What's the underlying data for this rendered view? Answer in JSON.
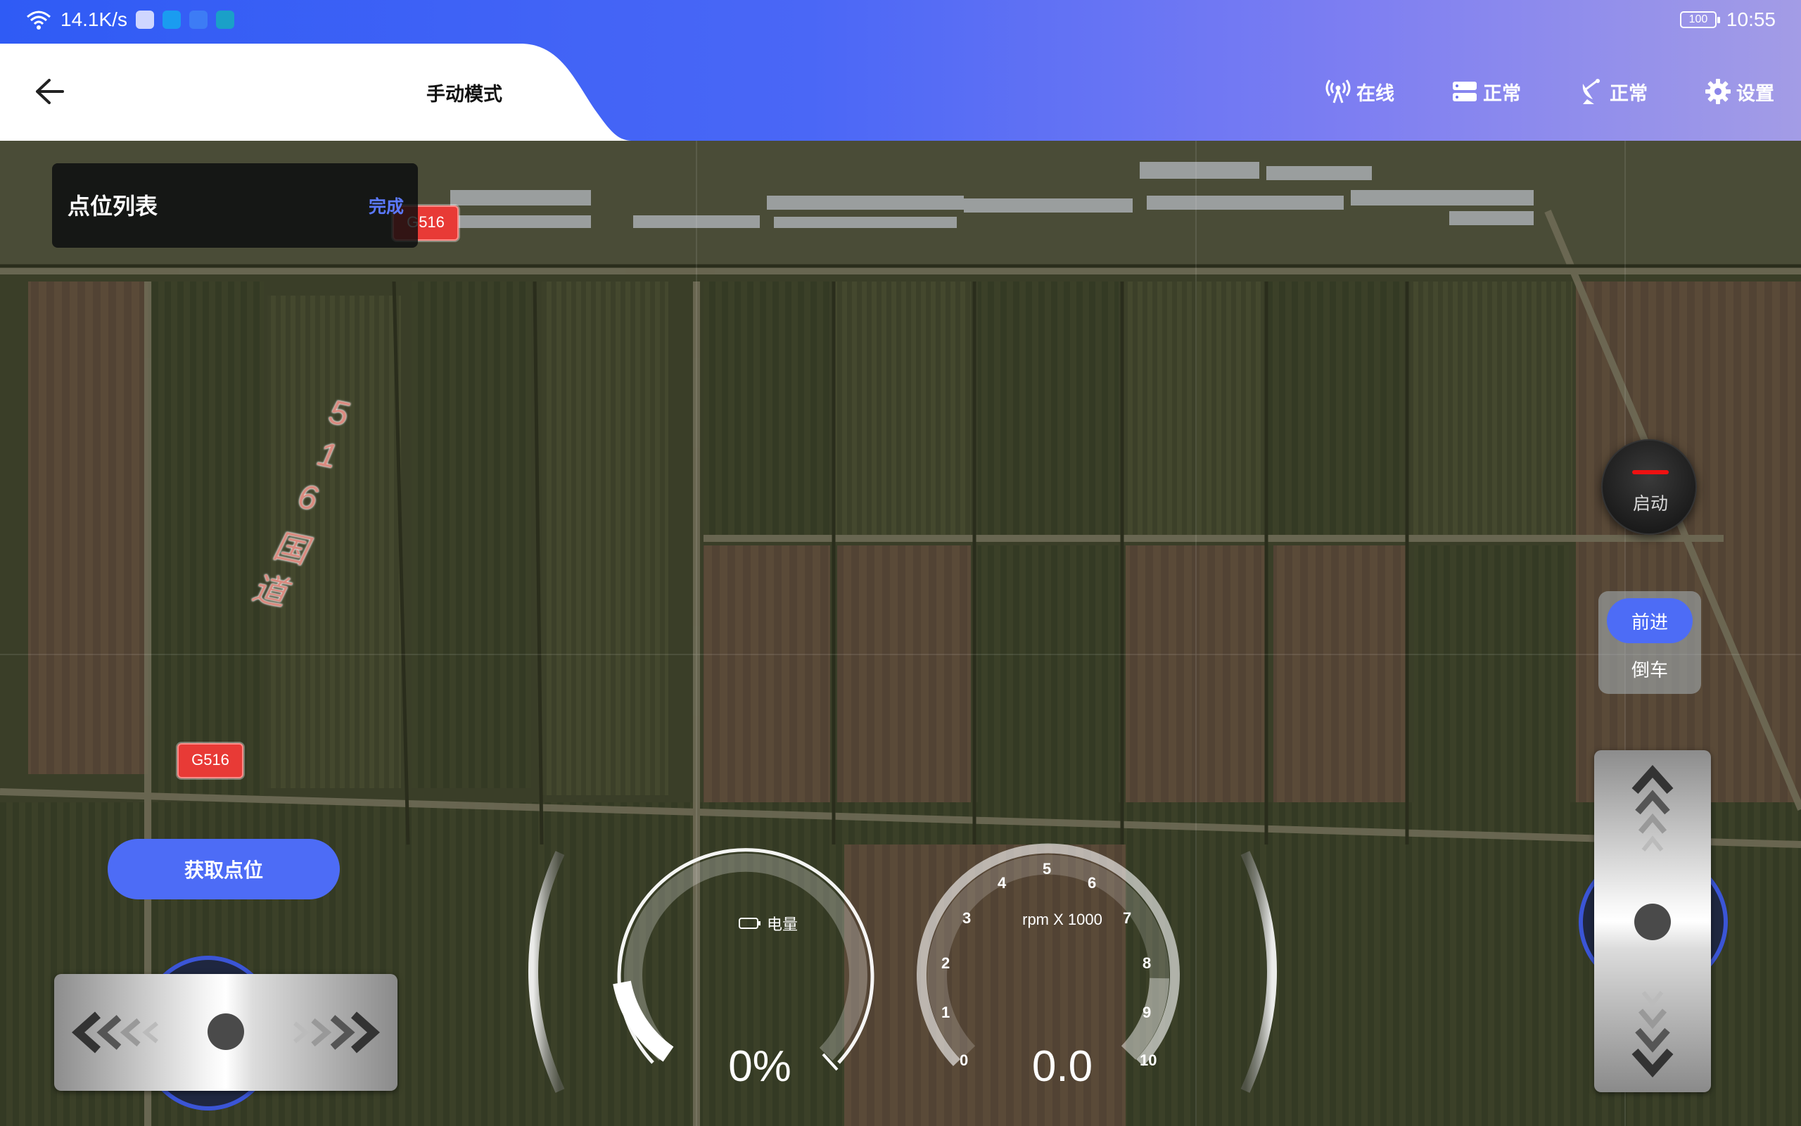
{
  "status_bar": {
    "net_speed": "14.1K/s",
    "battery_level": "100",
    "time": "10:55",
    "wifi_icon": "wifi-icon",
    "notification_icons": [
      "gallery-app-icon",
      "search-app-icon",
      "cloud-app-icon",
      "weather-app-icon"
    ]
  },
  "header": {
    "title": "手动模式",
    "back_icon": "arrow-left-icon",
    "status": [
      {
        "icon": "signal-tower-icon",
        "label": "在线"
      },
      {
        "icon": "server-icon",
        "label": "正常"
      },
      {
        "icon": "satellite-dish-icon",
        "label": "正常"
      },
      {
        "icon": "gear-icon",
        "label": "设置"
      }
    ]
  },
  "point_list": {
    "title": "点位列表",
    "done_label": "完成"
  },
  "map": {
    "road_badges": [
      "G516",
      "G516"
    ],
    "road_name": [
      "5",
      "1",
      "6",
      "国",
      "道"
    ]
  },
  "controls": {
    "get_point_label": "获取点位",
    "start_label": "启动",
    "gear_forward": "前进",
    "gear_reverse": "倒车",
    "gear_selected": "前进"
  },
  "gauges": {
    "battery": {
      "label": "电量",
      "value": "0%",
      "fraction": 0.0
    },
    "rpm": {
      "unit_label": "rpm X 1000",
      "value": "0.0",
      "ticks": [
        "0",
        "1",
        "2",
        "3",
        "4",
        "5",
        "6",
        "7",
        "8",
        "9",
        "10"
      ]
    }
  },
  "colors": {
    "accent": "#4d6cf6",
    "header_gradient_start": "#2f5bf5",
    "header_gradient_end": "#a39ce6",
    "road_badge": "#e83a36",
    "start_indicator": "#e11111"
  }
}
